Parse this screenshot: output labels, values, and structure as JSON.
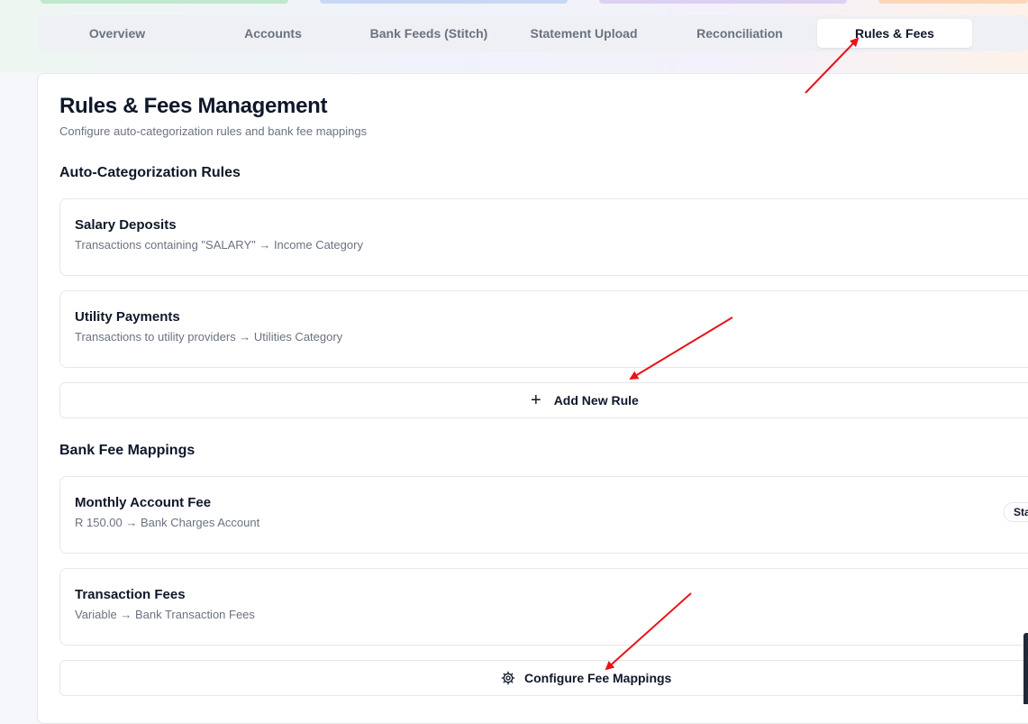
{
  "tabs": [
    {
      "label": "Overview"
    },
    {
      "label": "Accounts"
    },
    {
      "label": "Bank Feeds (Stitch)"
    },
    {
      "label": "Statement Upload"
    },
    {
      "label": "Reconciliation"
    },
    {
      "label": "Rules & Fees",
      "active": true
    }
  ],
  "page": {
    "title": "Rules & Fees Management",
    "subtitle": "Configure auto-categorization rules and bank fee mappings"
  },
  "rules_section": {
    "heading": "Auto-Categorization Rules",
    "items": [
      {
        "name": "Salary Deposits",
        "description": "Transactions containing \"SALARY\" → Income Category"
      },
      {
        "name": "Utility Payments",
        "description": "Transactions to utility providers → Utilities Category"
      }
    ],
    "add_button": {
      "icon": "plus-icon",
      "label": "Add New Rule"
    }
  },
  "fees_section": {
    "heading": "Bank Fee Mappings",
    "items": [
      {
        "name": "Monthly Account Fee",
        "description": "R 150.00 → Bank Charges Account",
        "badge": "Sta"
      },
      {
        "name": "Transaction Fees",
        "description": "Variable → Bank Transaction Fees"
      }
    ],
    "configure_button": {
      "icon": "gear-icon",
      "label": "Configure Fee Mappings"
    }
  },
  "annotation_color": "#e8131b"
}
